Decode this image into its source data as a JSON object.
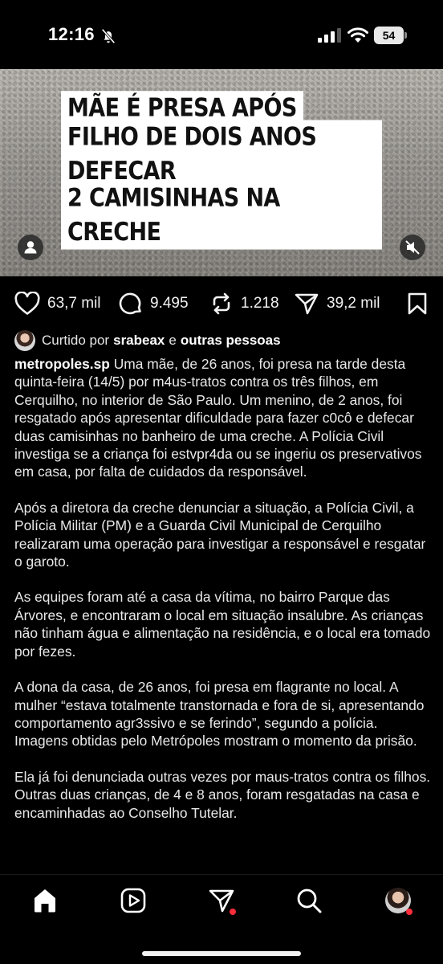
{
  "status_bar": {
    "time": "12:16",
    "battery": "54",
    "icons": [
      "bell-slash-icon",
      "signal-icon",
      "wifi-icon",
      "battery-icon"
    ]
  },
  "post_media": {
    "headline_lines": [
      "MÃE É PRESA APÓS",
      "FILHO DE DOIS ANOS DEFECAR",
      "2 CAMISINHAS NA CRECHE"
    ],
    "icons": [
      "user-tag-icon",
      "sound-off-icon"
    ]
  },
  "actions": {
    "likes": "63,7 mil",
    "comments": "9.495",
    "reposts": "1.218",
    "shares": "39,2 mil",
    "icons": [
      "heart-icon",
      "comment-icon",
      "repost-icon",
      "send-icon",
      "bookmark-icon"
    ]
  },
  "liked_by": {
    "prefix": "Curtido por",
    "user": "srabeax",
    "conjunction": "e",
    "others": "outras pessoas"
  },
  "caption": {
    "username": "metropoles.sp",
    "paragraphs": [
      "Uma mãe, de 26 anos, foi presa na tarde desta quinta-feira (14/5) por m4us-tratos contra os três filhos, em Cerquilho, no interior de São Paulo. Um menino, de 2 anos, foi resgatado após apresentar dificuldade para fazer c0cô e defecar duas camisinhas no banheiro de uma creche. A Polícia Civil investiga se a criança foi estvpr4da ou se ingeriu os preservativos em casa, por falta de cuidados da responsável.",
      "Após a diretora da creche denunciar a situação, a Polícia Civil, a Polícia Militar (PM) e a Guarda Civil Municipal de Cerquilho realizaram uma operação para investigar a responsável e resgatar o garoto.",
      "As equipes foram até a casa da vítima, no bairro Parque das Árvores, e encontraram o local em situação insalubre. As crianças não tinham água e alimentação na residência, e o local era tomado por fezes.",
      "A dona da casa, de 26 anos, foi presa em flagrante no local. A mulher “estava totalmente transtornada e fora de si, apresentando comportamento agr3ssivo e se ferindo”, segundo a polícia. Imagens obtidas pelo Metrópoles mostram o momento da prisão.",
      "Ela já foi denunciada outras vezes por maus-tratos contra os filhos. Outras duas crianças, de 4 e 8 anos, foram resgatadas na casa e encaminhadas ao Conselho Tutelar."
    ]
  },
  "bottom_nav": {
    "items": [
      "home-icon",
      "reels-icon",
      "direct-icon",
      "search-icon",
      "profile-avatar"
    ],
    "notification_color": "#ff2d3b"
  }
}
